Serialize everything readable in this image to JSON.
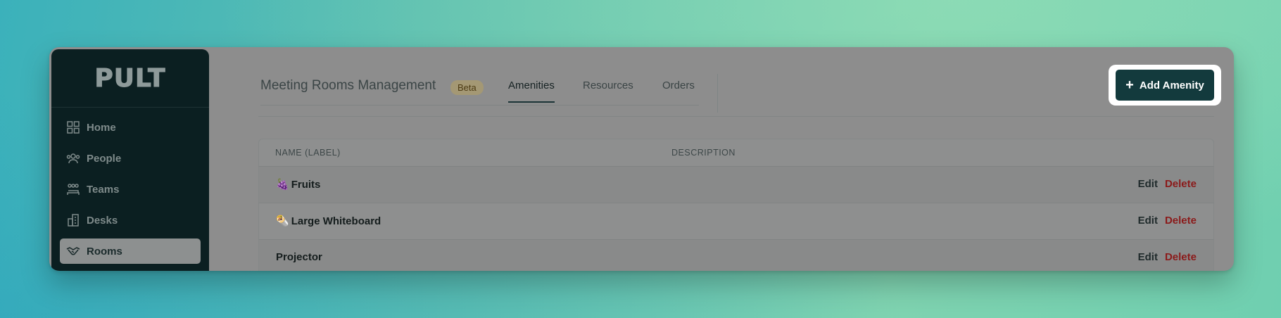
{
  "app": {
    "logo": "PULT"
  },
  "sidebar": {
    "items": [
      {
        "label": "Home",
        "icon": "grid-icon",
        "active": false
      },
      {
        "label": "People",
        "icon": "people-icon",
        "active": false
      },
      {
        "label": "Teams",
        "icon": "teams-icon",
        "active": false
      },
      {
        "label": "Desks",
        "icon": "desks-icon",
        "active": false
      },
      {
        "label": "Rooms",
        "icon": "handshake-icon",
        "active": true
      }
    ]
  },
  "header": {
    "title": "Meeting Rooms Management",
    "badge": "Beta",
    "tabs": [
      {
        "label": "Amenities",
        "active": true
      },
      {
        "label": "Resources",
        "active": false
      },
      {
        "label": "Orders",
        "active": false
      }
    ],
    "add_button_label": "Add Amenity"
  },
  "table": {
    "columns": [
      "NAME (LABEL)",
      "DESCRIPTION"
    ],
    "rows": [
      {
        "emoji": "🍇",
        "name": "Fruits",
        "description": "",
        "edit": "Edit",
        "delete": "Delete"
      },
      {
        "emoji": "🌯",
        "name": "Large Whiteboard",
        "description": "",
        "edit": "Edit",
        "delete": "Delete"
      },
      {
        "emoji": "",
        "name": "Projector",
        "description": "",
        "edit": "Edit",
        "delete": "Delete"
      }
    ]
  },
  "colors": {
    "sidebar_bg": "#0b1f21",
    "primary_button": "#133a3d",
    "delete_text": "#8b1a1a",
    "beta_badge": "#a49874"
  }
}
